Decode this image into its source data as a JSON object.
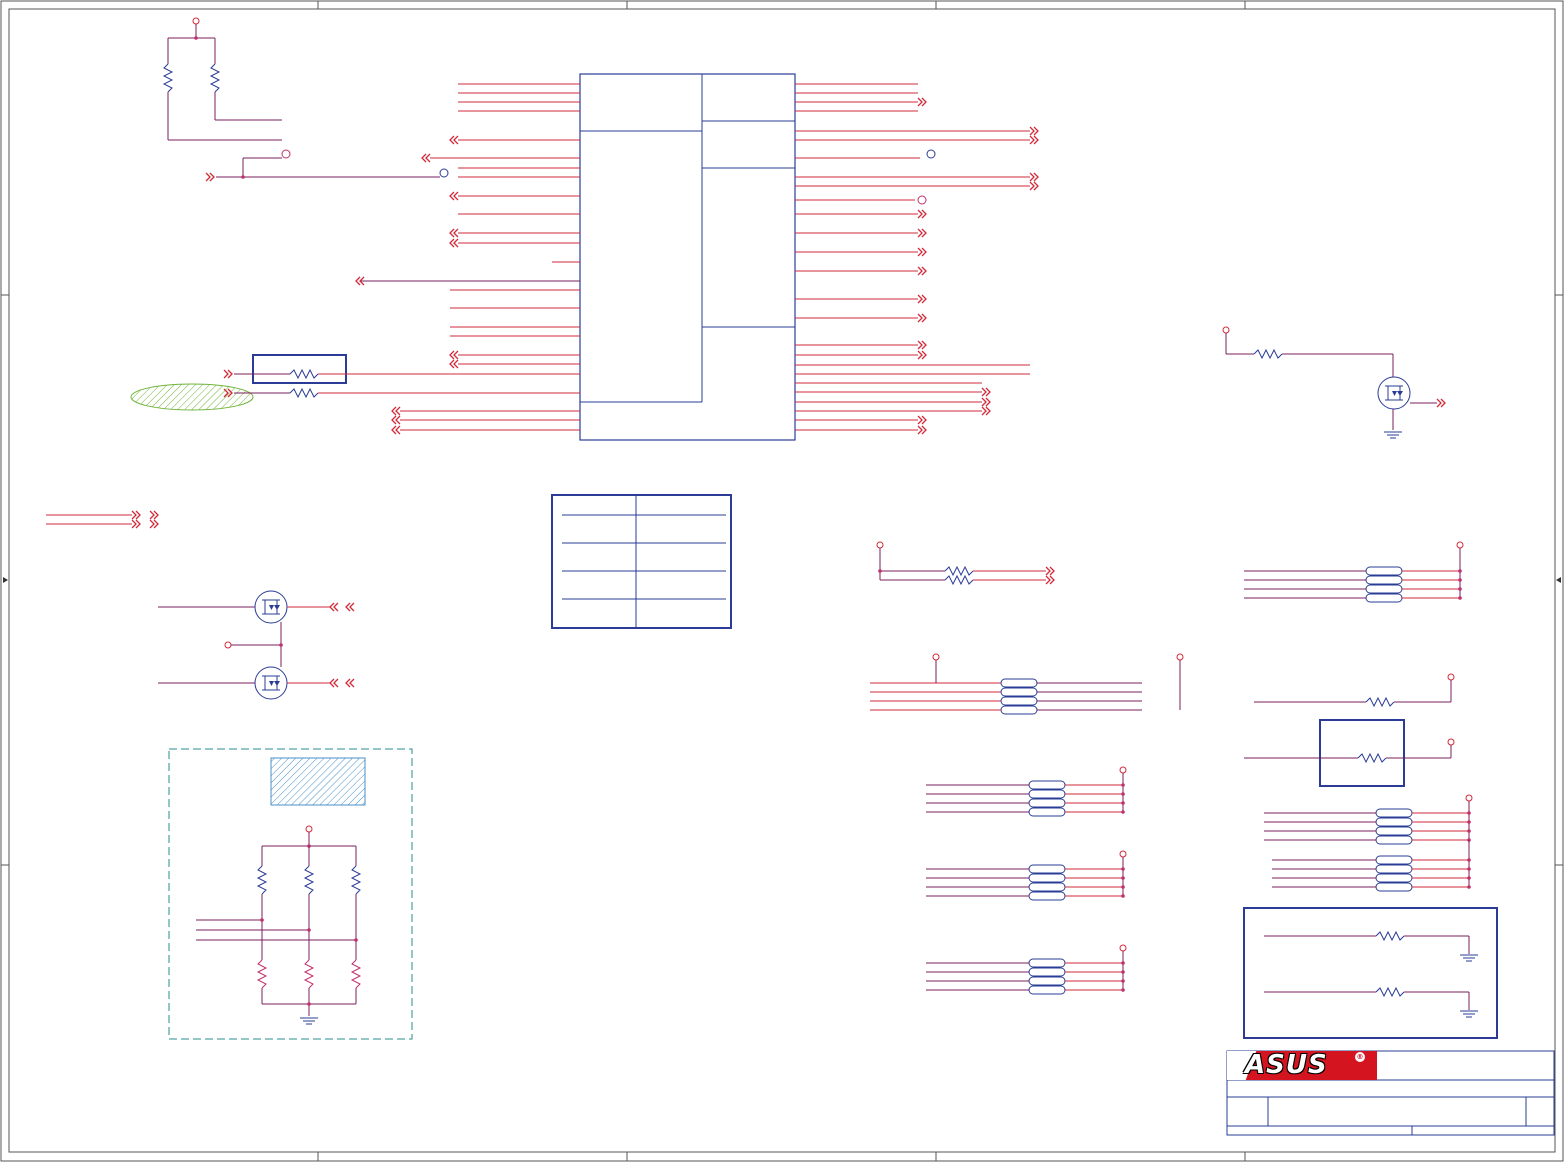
{
  "title_block": {
    "logo_text": "ASUS",
    "registered_mark": "®"
  },
  "colors": {
    "border": "#555555",
    "wire_red": "#d12a3a",
    "net_purple": "#7a1f5e",
    "component_blue": "#2a3c96",
    "junction": "#c0306a",
    "keepout_green": "#6fb53a",
    "hatch_blue": "#4a90c8",
    "dashed_box": "#2a8c8c",
    "brand_red": "#d4141e"
  },
  "icons": {
    "resistor": "resistor-icon",
    "mosfet": "mosfet-icon",
    "ground": "ground-icon",
    "power_flag": "power-flag-icon",
    "offpage_connector": "offpage-connector-icon",
    "resistor_pack": "resistor-pack-icon"
  }
}
